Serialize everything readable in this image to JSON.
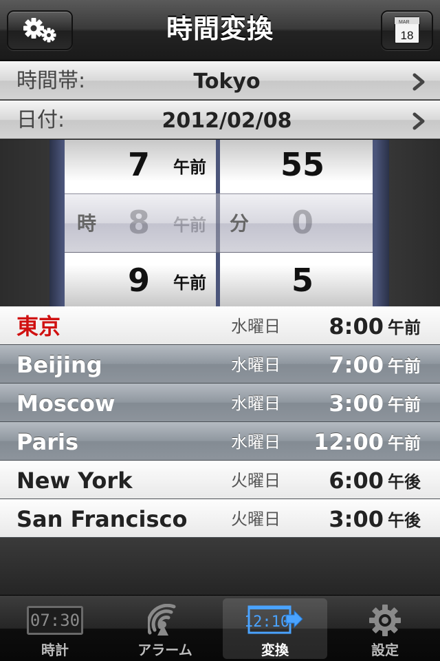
{
  "header": {
    "title": "時間変換",
    "settings_icon": "gears-icon",
    "calendar_icon": {
      "month": "MAR",
      "day": "18"
    }
  },
  "timezone_row": {
    "label": "時間帯:",
    "value": "Tokyo"
  },
  "date_row": {
    "label": "日付:",
    "value": "2012/02/08"
  },
  "picker": {
    "hour_unit": "時",
    "minute_unit": "分",
    "hours": [
      {
        "value": "7",
        "ampm": "午前"
      },
      {
        "value": "8",
        "ampm": "午前"
      },
      {
        "value": "9",
        "ampm": "午前"
      }
    ],
    "minutes": [
      "55",
      "0",
      "5"
    ]
  },
  "cities": [
    {
      "name": "東京",
      "day": "水曜日",
      "time": "8:00",
      "ampm": "午前",
      "style": "light",
      "current": true
    },
    {
      "name": "Beijing",
      "day": "水曜日",
      "time": "7:00",
      "ampm": "午前",
      "style": "dark",
      "current": false
    },
    {
      "name": "Moscow",
      "day": "水曜日",
      "time": "3:00",
      "ampm": "午前",
      "style": "dark",
      "current": false
    },
    {
      "name": "Paris",
      "day": "水曜日",
      "time": "12:00",
      "ampm": "午前",
      "style": "dark",
      "current": false
    },
    {
      "name": "New York",
      "day": "火曜日",
      "time": "6:00",
      "ampm": "午後",
      "style": "light",
      "current": false
    },
    {
      "name": "San Francisco",
      "day": "火曜日",
      "time": "3:00",
      "ampm": "午後",
      "style": "light",
      "current": false
    }
  ],
  "tabs": [
    {
      "label": "時計",
      "icon": "digital-clock-icon",
      "icon_text": "07:30",
      "selected": false
    },
    {
      "label": "アラーム",
      "icon": "alarm-signal-icon",
      "selected": false
    },
    {
      "label": "変換",
      "icon": "convert-clock-icon",
      "icon_text": "12:10",
      "selected": true
    },
    {
      "label": "設定",
      "icon": "gear-icon",
      "selected": false
    }
  ],
  "colors": {
    "current_city": "#d01010",
    "convert_tab_icon": "#4aa3ff"
  }
}
